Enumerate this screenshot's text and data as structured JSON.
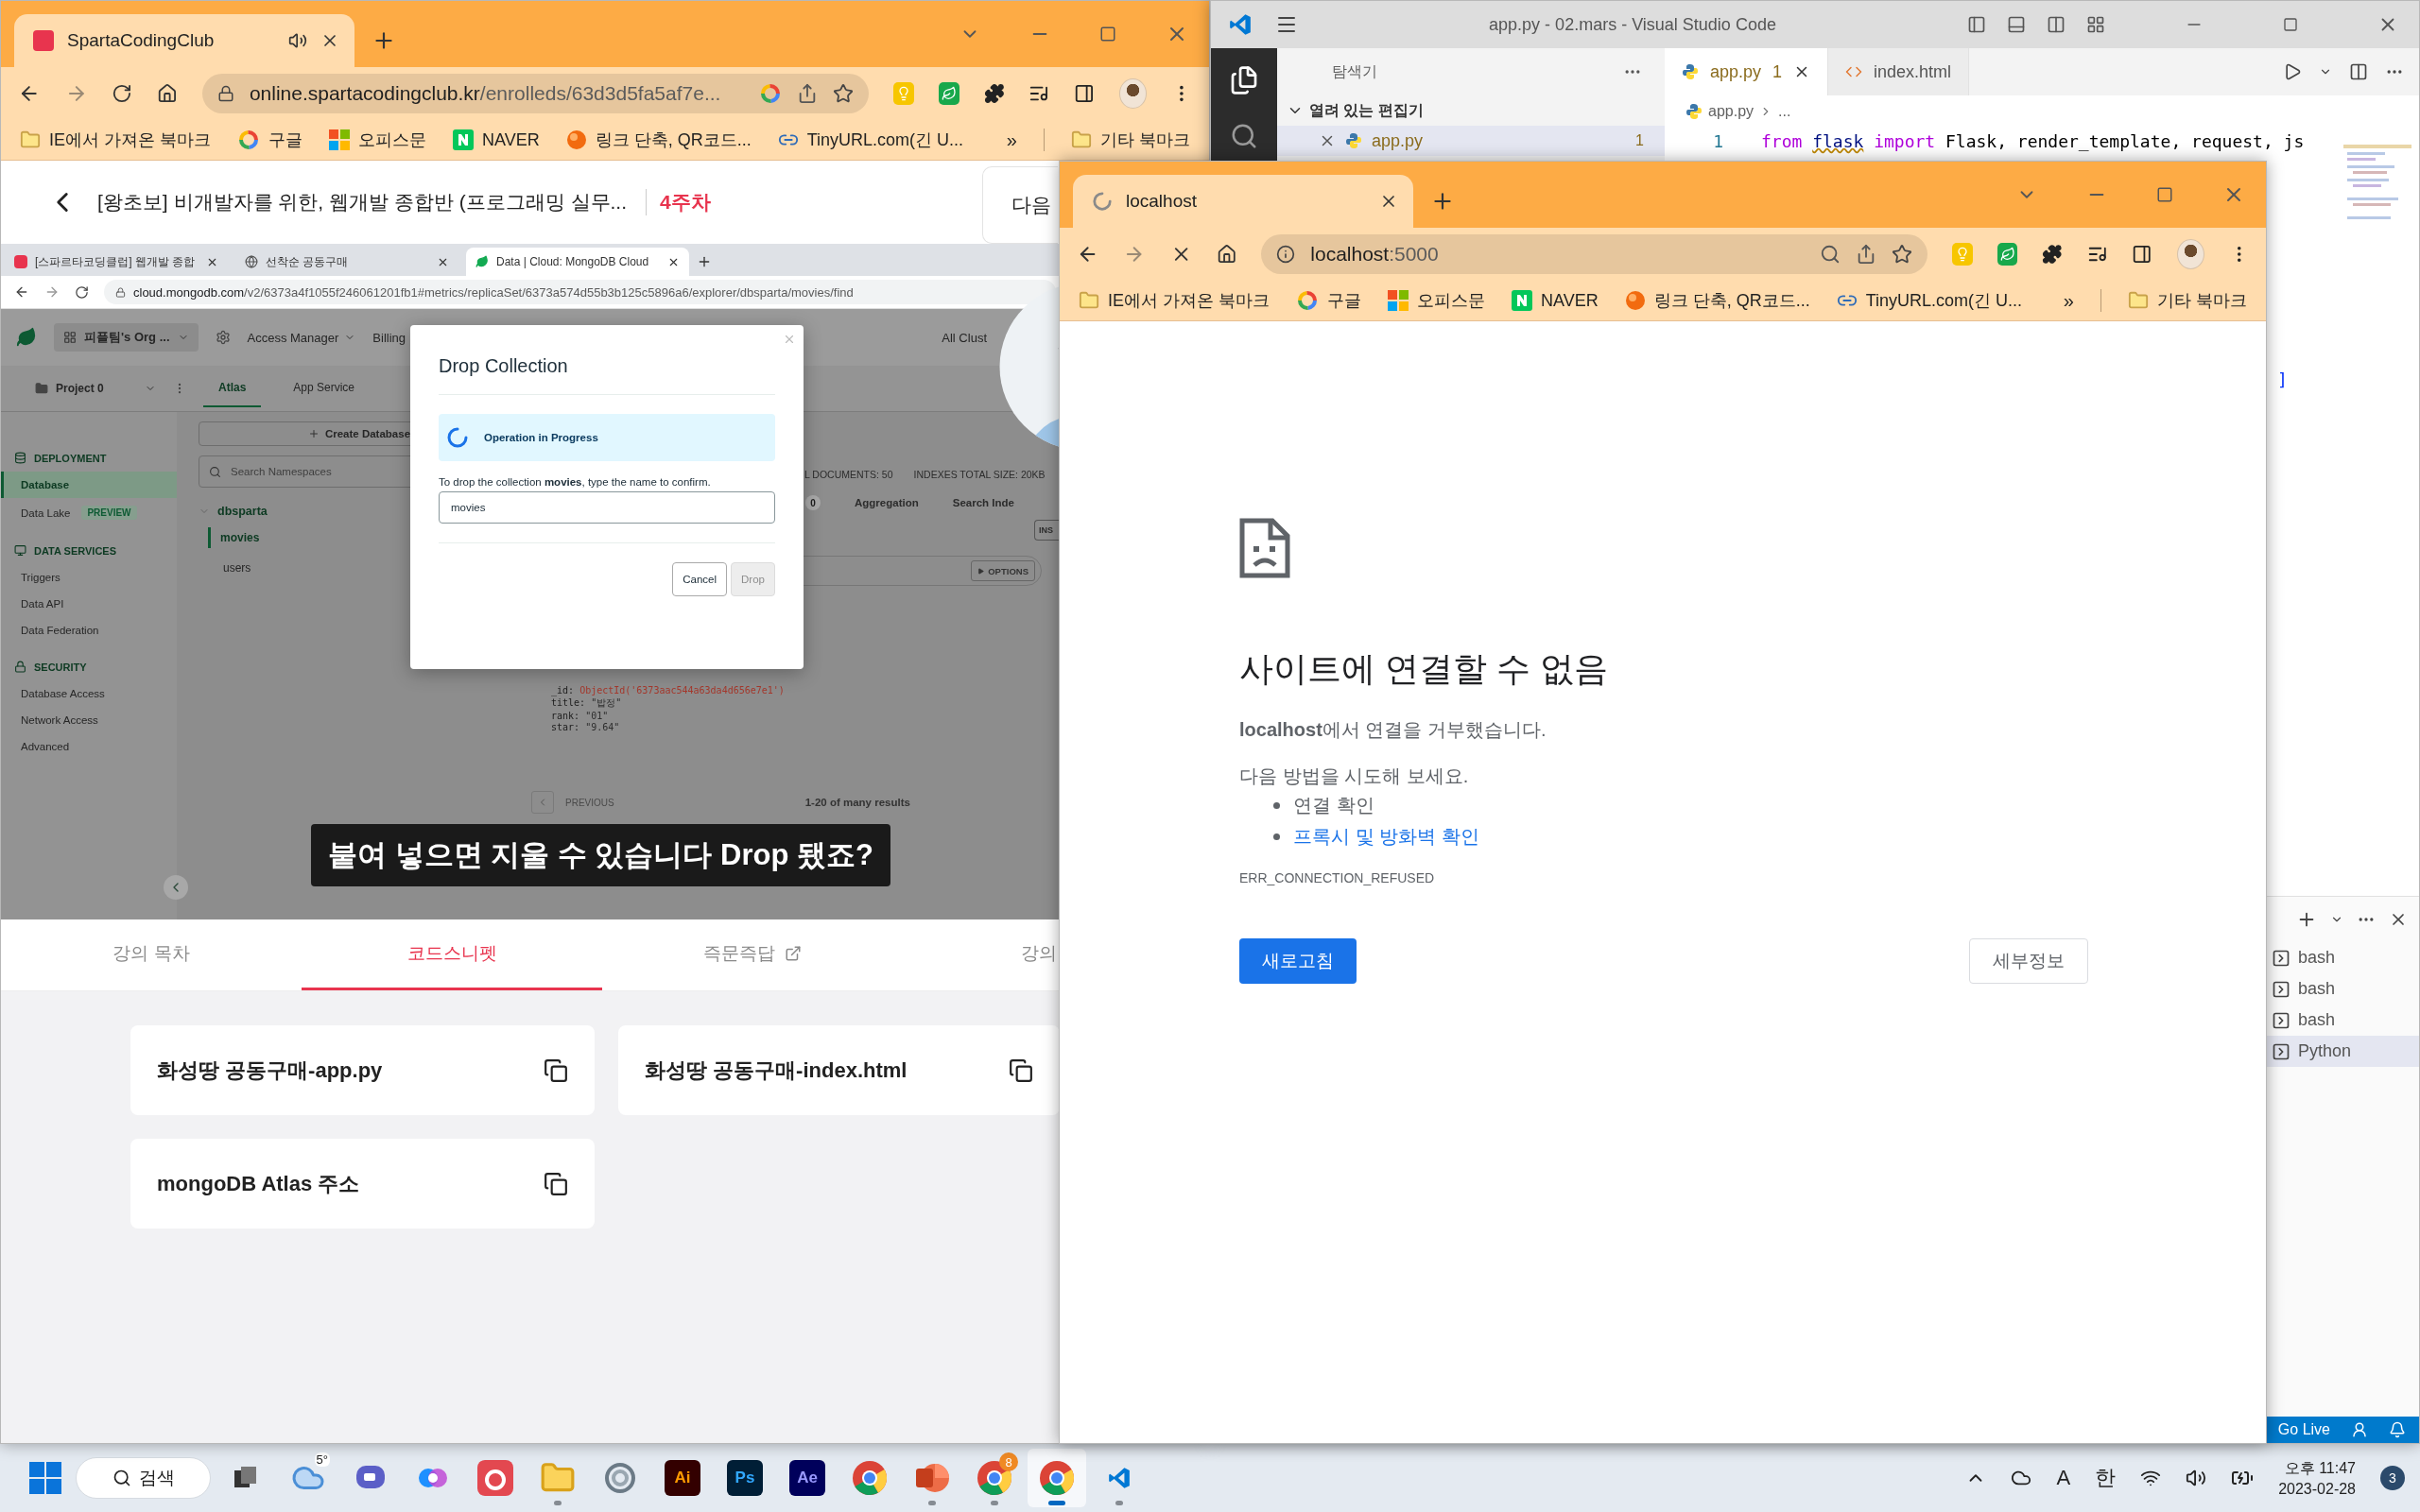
{
  "left_browser": {
    "tabs": [
      {
        "title": "SpartaCodingClub",
        "selected": true,
        "loading": false,
        "audio": true
      }
    ],
    "secure": true,
    "url_host": "online.spartacodingclub.kr",
    "url_path": "/enrolleds/63d3d5fa5af7e...",
    "bookmarks": [
      {
        "label": "IE에서 가져온 북마크",
        "kind": "folder"
      },
      {
        "label": "구글",
        "kind": "google"
      },
      {
        "label": "오피스문",
        "kind": "office"
      },
      {
        "label": "NAVER",
        "kind": "naver"
      },
      {
        "label": "링크 단축, QR코드...",
        "kind": "orb"
      },
      {
        "label": "TinyURL.com(긴 U...",
        "kind": "link"
      }
    ],
    "bookmarks_more": "»",
    "other_bookmarks": "기타 북마크",
    "course": {
      "title": "[왕초보] 비개발자를 위한, 웹개발 종합반 (프로그래밍 실무...",
      "week": "4주차",
      "next_button": "다음"
    },
    "video": {
      "browser_tabs": [
        {
          "title": "[스파르타코딩클럽] 웹개발 종합",
          "kind": "sparta",
          "selected": false
        },
        {
          "title": "선착순 공동구매",
          "kind": "globe",
          "selected": false
        },
        {
          "title": "Data | Cloud: MongoDB Cloud",
          "kind": "mongo",
          "selected": true
        }
      ],
      "url_host": "cloud.mongodb.com",
      "url_path": "/v2/6373a4f1055f246061201fb1#metrics/replicaSet/6373a574d55b3b125c5896a6/explorer/dbsparta/movies/find",
      "org": "피플팀's Org ...",
      "top_nav": [
        "Access Manager",
        "Billing"
      ],
      "all_clusters": "All Clust",
      "project": "Project 0",
      "product_tabs": [
        {
          "label": "Atlas",
          "selected": true
        },
        {
          "label": "App Service",
          "selected": false
        }
      ],
      "sidebar": [
        {
          "title": "DEPLOYMENT",
          "kind": "deployment",
          "items": [
            {
              "label": "Database",
              "selected": true
            },
            {
              "label": "Data Lake",
              "badge": "PREVIEW",
              "selected": false
            }
          ]
        },
        {
          "title": "DATA SERVICES",
          "kind": "services",
          "items": [
            {
              "label": "Triggers",
              "selected": false
            },
            {
              "label": "Data API",
              "selected": false
            },
            {
              "label": "Data Federation",
              "selected": false
            }
          ]
        },
        {
          "title": "SECURITY",
          "kind": "security",
          "items": [
            {
              "label": "Database Access",
              "selected": false
            },
            {
              "label": "Network Access",
              "selected": false
            },
            {
              "label": "Advanced",
              "selected": false
            }
          ]
        }
      ],
      "create_database": "Create Database",
      "namespace_search": {
        "placeholder": "Search Namespaces"
      },
      "databases": [
        {
          "name": "dbsparta",
          "expanded": true,
          "children": [
            {
              "name": "movies",
              "selected": true
            },
            {
              "name": "users",
              "selected": false
            }
          ]
        }
      ],
      "stats": [
        "L DOCUMENTS: 50",
        "INDEXES TOTAL SIZE: 20KB"
      ],
      "collection_tabs": [
        {
          "label": "0",
          "kind": "count"
        },
        {
          "label": "Aggregation",
          "kind": "tab"
        },
        {
          "label": "Search Inde",
          "kind": "tab"
        }
      ],
      "insert_button": "INS",
      "options_button": "OPTIONS",
      "document": [
        {
          "key": "_id:",
          "value": "ObjectId('6373aac544a63da4d656e7e1')",
          "kind": "object_id"
        },
        {
          "key": "title:",
          "value": "\"밥정\"",
          "kind": "string"
        },
        {
          "key": "rank:",
          "value": "\"01\"",
          "kind": "string"
        },
        {
          "key": "star:",
          "value": "\"9.64\"",
          "kind": "string"
        }
      ],
      "pager": {
        "previous": "PREVIOUS",
        "range": "1-20 of many results"
      },
      "dialog": {
        "title": "Drop Collection",
        "status": "Operation in Progress",
        "message": "To drop the collection **movies**, type the name to confirm.",
        "value": "movies",
        "cancel": "Cancel",
        "confirm": "Drop",
        "confirm_disabled": true
      },
      "subtitle": "붙여 넣으면 지울 수 있습니다 Drop 됐죠?"
    },
    "lesson_tabs": [
      {
        "label": "강의 목차",
        "selected": false,
        "external": false
      },
      {
        "label": "코드스니펫",
        "selected": true,
        "external": false
      },
      {
        "label": "즉문즉답",
        "selected": false,
        "external": true
      },
      {
        "label": "강의",
        "selected": false,
        "external": false
      }
    ],
    "snippets": [
      "화성땅 공동구매-app.py",
      "화성땅 공동구매-index.html",
      "mongoDB Atlas 주소"
    ]
  },
  "vscode": {
    "title": "app.py - 02.mars - Visual Studio Code",
    "explorer_title": "탐색기",
    "open_editors": {
      "title": "열려 있는 편집기",
      "expanded": true,
      "files": [
        {
          "name": "app.py",
          "problems": "1",
          "selected": true
        }
      ]
    },
    "tabs": [
      {
        "name": "app.py",
        "problems": "1",
        "kind": "python",
        "selected": true
      },
      {
        "name": "index.html",
        "kind": "html",
        "selected": false
      }
    ],
    "breadcrumb": [
      "app.py",
      "..."
    ],
    "code": [
      {
        "number": "1",
        "tokens": [
          {
            "text": "from",
            "kind": "keyword"
          },
          {
            "text": "flask",
            "kind": "warning"
          },
          {
            "text": "import",
            "kind": "keyword"
          },
          {
            "text": "Flask, render_template, request, js",
            "kind": "plain"
          }
        ]
      }
    ],
    "code_fragment": "]",
    "terminals": [
      {
        "name": "bash",
        "selected": false
      },
      {
        "name": "bash",
        "selected": false
      },
      {
        "name": "bash",
        "selected": false
      },
      {
        "name": "Python",
        "selected": true
      }
    ],
    "status": {
      "go_live": "Go Live"
    }
  },
  "right_browser": {
    "tabs": [
      {
        "title": "localhost",
        "selected": true,
        "loading": true,
        "audio": false
      }
    ],
    "secure": false,
    "url_host": "localhost",
    "url_path": ":5000",
    "bookmarks": [
      {
        "label": "IE에서 가져온 북마크",
        "kind": "folder"
      },
      {
        "label": "구글",
        "kind": "google"
      },
      {
        "label": "오피스문",
        "kind": "office"
      },
      {
        "label": "NAVER",
        "kind": "naver"
      },
      {
        "label": "링크 단축, QR코드...",
        "kind": "orb"
      },
      {
        "label": "TinyURL.com(긴 U...",
        "kind": "link"
      }
    ],
    "bookmarks_more": "»",
    "other_bookmarks": "기타 북마크",
    "error": {
      "title": "사이트에 연결할 수 없음",
      "message": "**localhost**에서 연결을 거부했습니다.",
      "suggestions_title": "다음 방법을 시도해 보세요.",
      "suggestions": [
        {
          "text": "연결 확인",
          "kind": "text"
        },
        {
          "text": "프록시 및 방화벽 확인",
          "kind": "link"
        }
      ],
      "code": "ERR_CONNECTION_REFUSED",
      "reload": "새로고침",
      "details": "세부정보"
    }
  },
  "taskbar": {
    "search": "검색",
    "apps": [
      {
        "kind": "task_view",
        "running": false,
        "selected": false
      },
      {
        "kind": "weather",
        "label": "5°",
        "running": false,
        "selected": false
      },
      {
        "kind": "teams",
        "running": false,
        "selected": false
      },
      {
        "kind": "copilot",
        "running": false,
        "selected": false
      },
      {
        "kind": "creative_cloud",
        "running": false,
        "selected": false
      },
      {
        "kind": "explorer",
        "running": true,
        "selected": false
      },
      {
        "kind": "snipping",
        "running": false,
        "selected": false
      },
      {
        "kind": "illustrator",
        "label": "Ai",
        "running": false,
        "selected": false
      },
      {
        "kind": "photoshop",
        "label": "Ps",
        "running": false,
        "selected": false
      },
      {
        "kind": "after_effects",
        "label": "Ae",
        "running": false,
        "selected": false
      },
      {
        "kind": "chrome",
        "running": false,
        "selected": false
      },
      {
        "kind": "powerpoint",
        "running": true,
        "selected": false
      },
      {
        "kind": "chrome",
        "badge": "8",
        "running": true,
        "selected": false
      },
      {
        "kind": "chrome",
        "running": true,
        "selected": true
      },
      {
        "kind": "vscode",
        "running": true,
        "selected": false
      }
    ],
    "tray": {
      "ime_mode": "A",
      "ime_lang": "한",
      "time": "오후 11:47",
      "date": "2023-02-28",
      "notifications": "3"
    }
  }
}
